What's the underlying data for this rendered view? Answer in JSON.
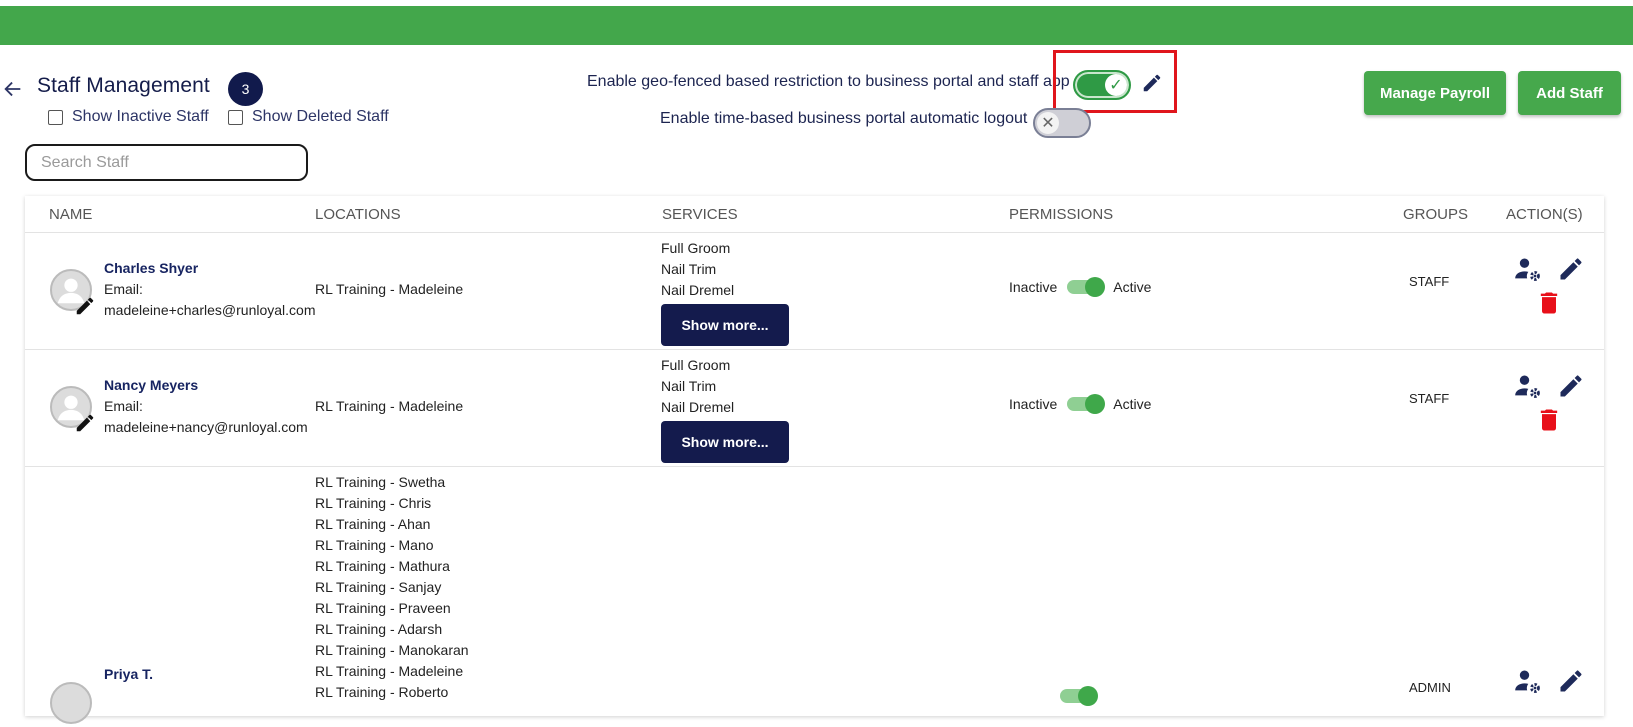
{
  "header": {
    "title": "Staff Management",
    "staff_count": "3",
    "show_inactive_label": "Show Inactive Staff",
    "show_deleted_label": "Show Deleted Staff",
    "search_placeholder": "Search Staff"
  },
  "settings": {
    "geofence_label": "Enable geo-fenced based restriction to business portal and staff app",
    "geofence_enabled": true,
    "auto_logout_label": "Enable time-based business portal automatic logout",
    "auto_logout_enabled": false
  },
  "buttons": {
    "manage_payroll": "Manage Payroll",
    "add_staff": "Add Staff"
  },
  "table": {
    "columns": [
      "NAME",
      "LOCATIONS",
      "SERVICES",
      "PERMISSIONS",
      "GROUPS",
      "ACTION(S)"
    ],
    "rows": [
      {
        "name": "Charles Shyer",
        "email_label": "Email:",
        "email": "madeleine+charles@runloyal.com",
        "locations": [
          "RL Training - Madeleine"
        ],
        "services": [
          "Full Groom",
          "Nail Trim",
          "Nail Dremel"
        ],
        "show_more": "Show more...",
        "permission_off": "Inactive",
        "permission_on": "Active",
        "group": "STAFF"
      },
      {
        "name": "Nancy Meyers",
        "email_label": "Email:",
        "email": "madeleine+nancy@runloyal.com",
        "locations": [
          "RL Training - Madeleine"
        ],
        "services": [
          "Full Groom",
          "Nail Trim",
          "Nail Dremel"
        ],
        "show_more": "Show more...",
        "permission_off": "Inactive",
        "permission_on": "Active",
        "group": "STAFF"
      },
      {
        "name": "Priya T.",
        "locations": [
          "RL Training - Swetha",
          "RL Training - Chris",
          "RL Training - Ahan",
          "RL Training - Mano",
          "RL Training - Mathura",
          "RL Training - Sanjay",
          "RL Training - Praveen",
          "RL Training - Adarsh",
          "RL Training - Manokaran",
          "RL Training - Madeleine",
          "RL Training - Roberto"
        ],
        "group": "ADMIN"
      }
    ]
  },
  "colors": {
    "brand_green": "#43a74b",
    "navy": "#141b4d",
    "delete_red": "#e8101a",
    "highlight_red": "#e0161c"
  }
}
